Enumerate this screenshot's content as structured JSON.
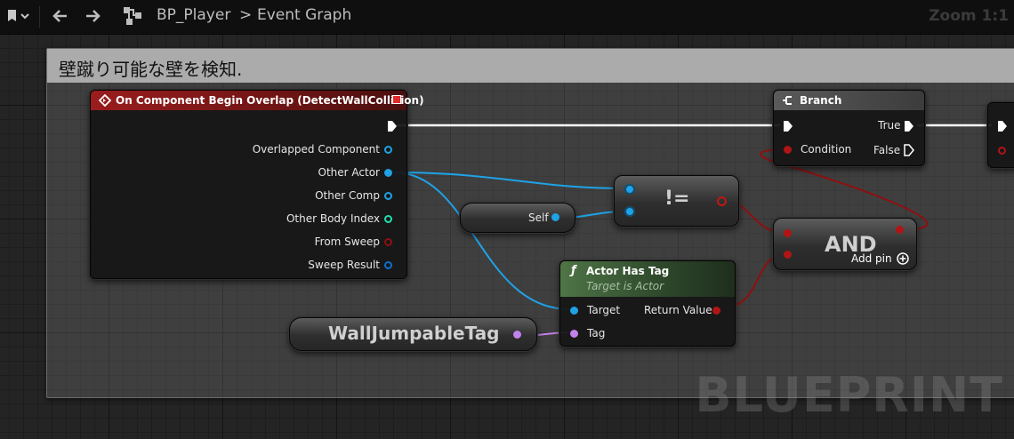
{
  "toolbar": {
    "breadcrumb_blueprint": "BP_Player",
    "breadcrumb_separator": ">",
    "breadcrumb_graph": "Event Graph",
    "zoom": "Zoom 1:1"
  },
  "comment": {
    "title": "壁蹴り可能な壁を検知."
  },
  "event_node": {
    "title": "On Component Begin Overlap (DetectWallCollision)",
    "pins": [
      "Overlapped Component",
      "Other Actor",
      "Other Comp",
      "Other Body Index",
      "From Sweep",
      "Sweep Result"
    ]
  },
  "self_node": {
    "label": "Self"
  },
  "not_equal_node": {
    "label": "!="
  },
  "branch_node": {
    "title": "Branch",
    "condition": "Condition",
    "true_label": "True",
    "false_label": "False"
  },
  "and_node": {
    "label": "AND",
    "add_pin": "Add pin"
  },
  "actor_has_tag_node": {
    "icon": "ƒ",
    "title": "Actor Has Tag",
    "subtitle": "Target is Actor",
    "target": "Target",
    "tag": "Tag",
    "return_value": "Return Value"
  },
  "tag_node": {
    "label": "WallJumpableTag"
  },
  "watermark": "BLUEPRINT",
  "colors": {
    "event_header": "#8c1a1a",
    "function_header": "#3e5a36",
    "object_pin": "#1fa2e6",
    "bool_pin": "#b01515",
    "name_pin": "#c282ec",
    "int_pin": "#1fe0b0",
    "struct_pin": "#0b6fd0",
    "exec": "#ffffff"
  }
}
